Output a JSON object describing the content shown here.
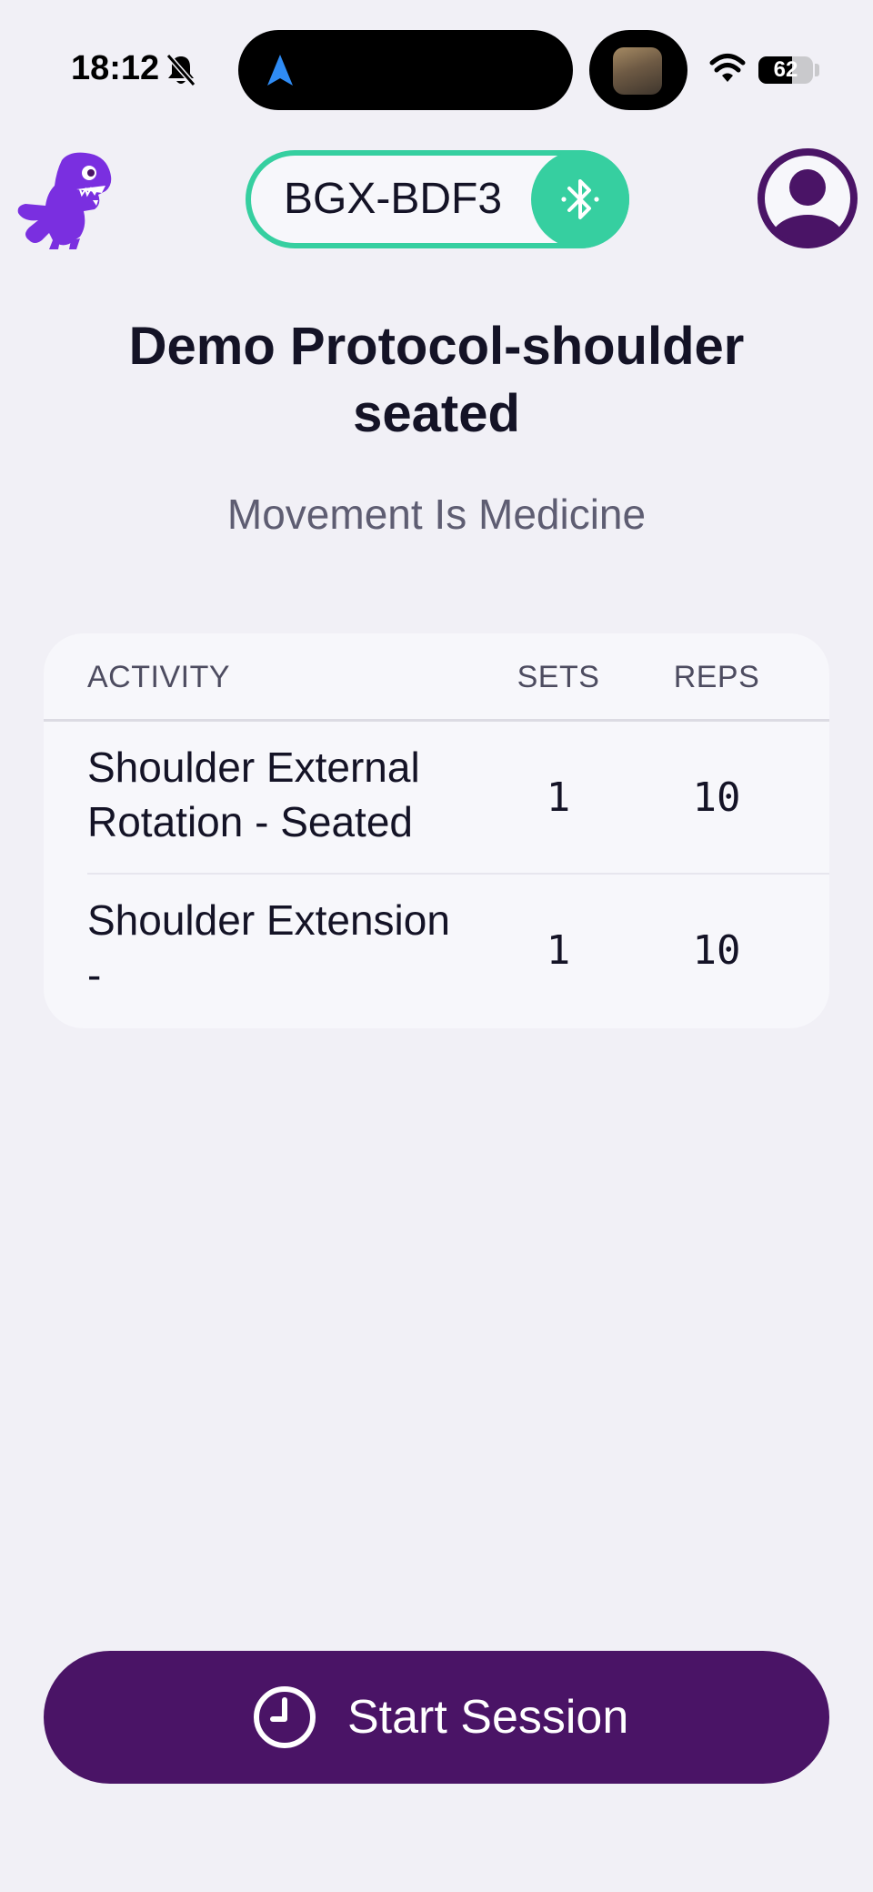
{
  "status_bar": {
    "time": "18:12",
    "battery_level": "62",
    "battery_fraction": 0.62,
    "icons": [
      "bell-slash-icon",
      "navigation-arrow-icon",
      "live-activity-thumbnail",
      "wifi-icon",
      "battery-icon"
    ]
  },
  "header": {
    "logo_icon": "dinosaur-logo-icon",
    "device_name": "BGX-BDF3",
    "device_icon": "bluetooth-icon",
    "profile_icon": "user-avatar-icon"
  },
  "protocol": {
    "title": "Demo Protocol-shoulder seated",
    "subtitle": "Movement Is Medicine"
  },
  "table": {
    "columns": {
      "activity": "ACTIVITY",
      "sets": "SETS",
      "reps": "REPS"
    },
    "rows": [
      {
        "activity": "Shoulder External Rotation - Seated",
        "sets": "1",
        "reps": "10"
      },
      {
        "activity": "Shoulder Extension -",
        "sets": "1",
        "reps": "10"
      }
    ]
  },
  "actions": {
    "start_label": "Start Session",
    "start_icon": "clock-icon"
  },
  "colors": {
    "background": "#f1f0f6",
    "accent_green": "#36cfa0",
    "brand_purple": "#4a1466",
    "logo_purple": "#7a2fe0"
  }
}
